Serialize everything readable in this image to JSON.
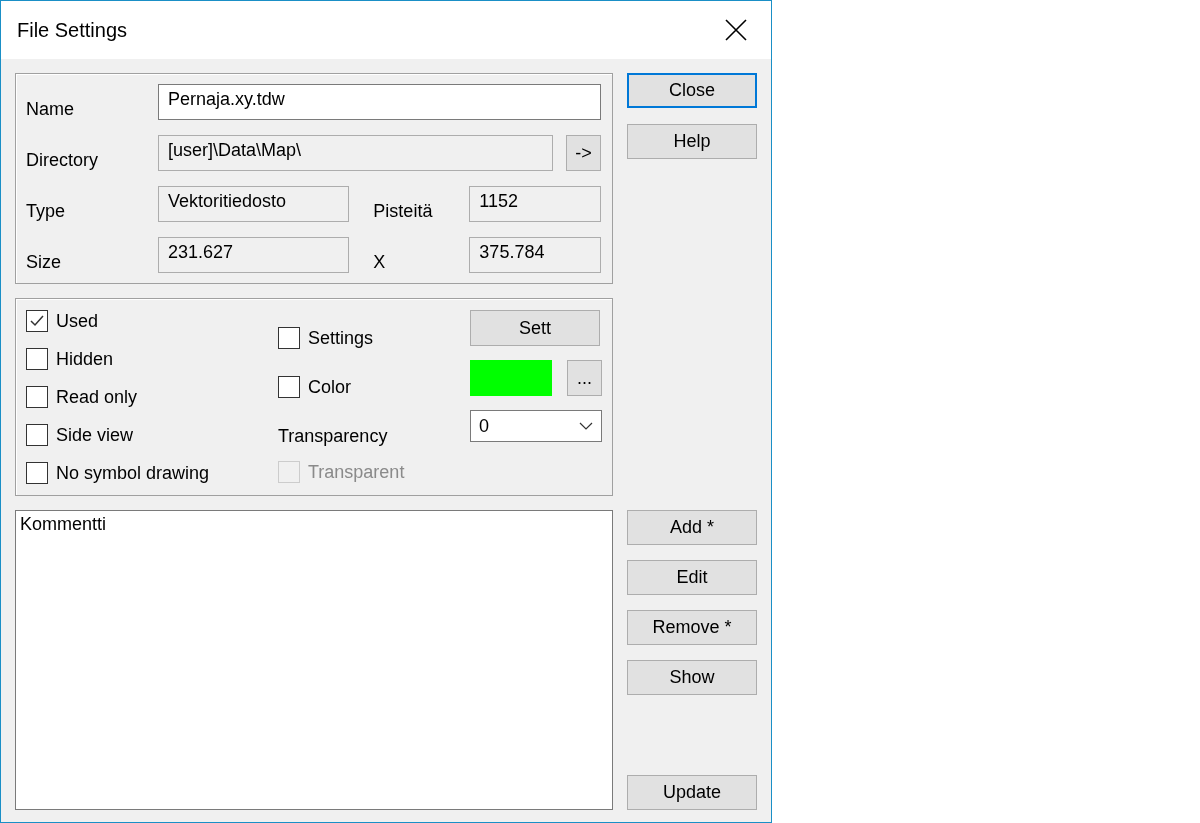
{
  "window": {
    "title": "File Settings"
  },
  "file_info": {
    "name": {
      "label": "Name",
      "value": "Pernaja.xy.tdw"
    },
    "directory": {
      "label": "Directory",
      "value": "[user]\\Data\\Map\\",
      "button": "->"
    },
    "type": {
      "label": "Type",
      "value": "Vektoritiedosto"
    },
    "points": {
      "label": "Pisteitä",
      "value": "1152"
    },
    "size": {
      "label": "Size",
      "value": "231.627"
    },
    "x": {
      "label": "X",
      "value": "375.784"
    }
  },
  "options": {
    "checkboxes": [
      {
        "label": "Used",
        "checked": true
      },
      {
        "label": "Hidden",
        "checked": false
      },
      {
        "label": "Read only",
        "checked": false
      },
      {
        "label": "Side view",
        "checked": false
      },
      {
        "label": "No symbol drawing",
        "checked": false
      }
    ],
    "settings": {
      "label": "Settings",
      "checked": false
    },
    "color_check": {
      "label": "Color",
      "checked": false
    },
    "transparency_label": "Transparency",
    "transparent": {
      "label": "Transparent",
      "checked": false,
      "disabled": true
    },
    "sett_button": "Sett",
    "color_swatch": {
      "color": "#00ff00"
    },
    "color_button": "...",
    "transparency_dropdown": {
      "value": "0"
    }
  },
  "comment": {
    "value": "Kommentti"
  },
  "top_buttons": [
    {
      "label": "Close",
      "focused": true
    },
    {
      "label": "Help",
      "focused": false
    }
  ],
  "list_buttons": [
    {
      "label": "Add *"
    },
    {
      "label": "Edit"
    },
    {
      "label": "Remove *"
    },
    {
      "label": "Show"
    }
  ],
  "update_button": "Update"
}
